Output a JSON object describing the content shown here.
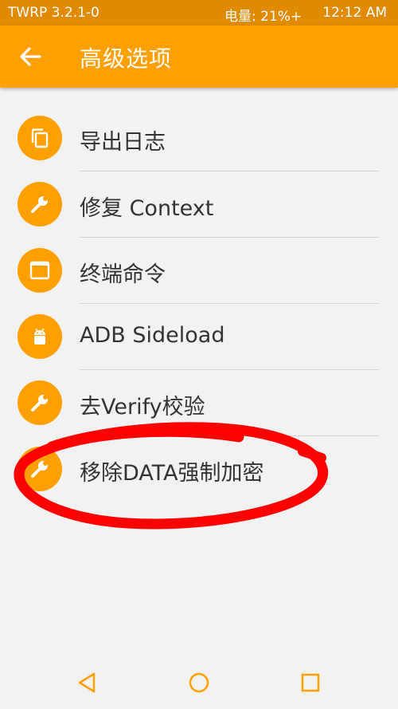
{
  "status_bar": {
    "app_version": "TWRP 3.2.1-0",
    "battery": "电量: 21%+",
    "time": "12:12 AM"
  },
  "header": {
    "title": "高级选项",
    "back_icon": "arrow-left-icon"
  },
  "menu": {
    "items": [
      {
        "label": "导出日志",
        "icon": "copy-icon"
      },
      {
        "label": "修复 Context",
        "icon": "wrench-icon"
      },
      {
        "label": "终端命令",
        "icon": "terminal-icon"
      },
      {
        "label": "ADB Sideload",
        "icon": "android-icon"
      },
      {
        "label": "去Verify校验",
        "icon": "wrench-icon"
      },
      {
        "label": "移除DATA强制加密",
        "icon": "wrench-icon"
      }
    ]
  },
  "nav": {
    "back_icon": "triangle-back-icon",
    "home_icon": "circle-home-icon",
    "recents_icon": "square-recents-icon"
  },
  "colors": {
    "accent": "#ff9f00",
    "status_bar": "#e08a00",
    "annotation": "#ff0000"
  }
}
